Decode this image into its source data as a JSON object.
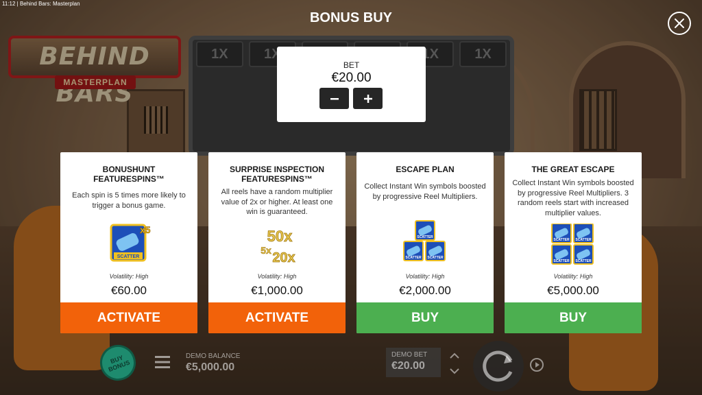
{
  "status_bar": {
    "text": "11:12 | Behind Bars: Masterplan"
  },
  "game": {
    "logo_title": "BEHIND BARS",
    "logo_subtitle": "MASTERPLAN",
    "multipliers": [
      "1X",
      "1X",
      "1X",
      "1X",
      "1X",
      "1X"
    ]
  },
  "header": {
    "title": "BONUS BUY"
  },
  "bet": {
    "label": "BET",
    "value": "€20.00"
  },
  "cards": [
    {
      "title": "BONUSHUNT FEATURESPINS™",
      "description": "Each spin is 5 times more likely to trigger a bonus game.",
      "icon_label": "SCATTER",
      "icon_badge": "x5",
      "volatility": "Volatility: High",
      "price": "€60.00",
      "button": "ACTIVATE",
      "button_color": "#f2620a"
    },
    {
      "title": "SURPRISE INSPECTION FEATURESPINS™",
      "description": "All reels have a random multiplier value of 2x or higher. At least one win is guaranteed.",
      "icon_values": [
        "50x",
        "5x",
        "20x"
      ],
      "volatility": "Volatility: High",
      "price": "€1,000.00",
      "button": "ACTIVATE",
      "button_color": "#f2620a"
    },
    {
      "title": "ESCAPE PLAN",
      "description": "Collect Instant Win symbols boosted by progressive Reel Multipliers.",
      "icon_label": "SCATTER",
      "volatility": "Volatility: High",
      "price": "€2,000.00",
      "button": "BUY",
      "button_color": "#4caf50"
    },
    {
      "title": "THE GREAT ESCAPE",
      "description": "Collect Instant Win symbols boosted by progressive Reel Multipliers. 3 random reels start with increased multiplier values.",
      "icon_label": "SCATTER",
      "volatility": "Volatility: High",
      "price": "€5,000.00",
      "button": "BUY",
      "button_color": "#4caf50"
    }
  ],
  "bottom_bar": {
    "buy_bonus_label": "BUY BONUS",
    "demo_balance_label": "DEMO BALANCE",
    "demo_balance_value": "€5,000.00",
    "demo_bet_label": "DEMO BET",
    "demo_bet_value": "€20.00"
  },
  "icons": {
    "close": "close-icon",
    "minus": "minus-icon",
    "plus": "plus-icon",
    "menu": "hamburger-menu-icon",
    "spin": "spin-icon",
    "autoplay": "autoplay-icon",
    "bet_up": "chevron-up-icon",
    "bet_down": "chevron-down-icon"
  }
}
